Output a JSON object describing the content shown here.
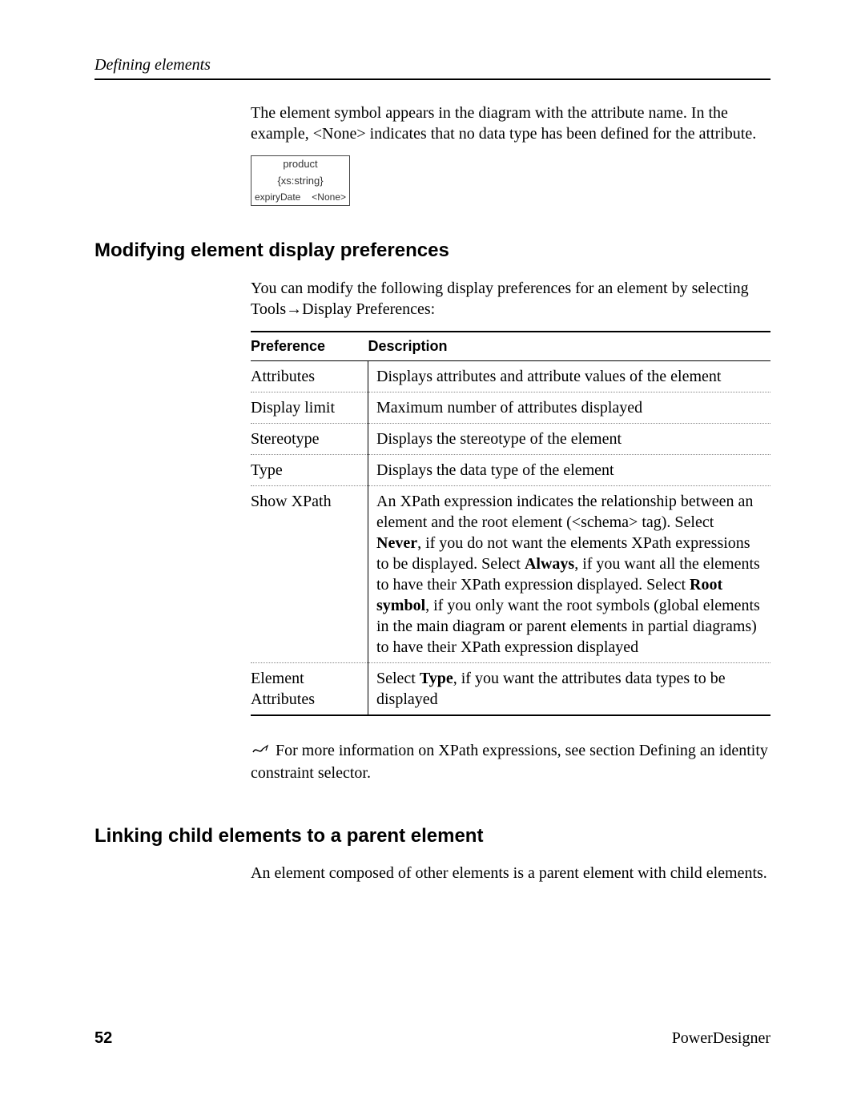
{
  "header": {
    "running_title": "Defining elements"
  },
  "intro_para": "The element symbol appears in the diagram with the attribute name. In the example, <None> indicates that no data type has been defined for the attribute.",
  "diagram": {
    "title": "product",
    "subtitle": "{xs:string}",
    "attr_name": "expiryDate",
    "attr_type": "<None>"
  },
  "section1": {
    "title": "Modifying element display preferences",
    "para_before": "You can modify the following display preferences for an element by selecting Tools",
    "arrow": "→",
    "para_after": "Display Preferences:",
    "table": {
      "col1": "Preference",
      "col2": "Description",
      "rows": [
        {
          "pref": "Attributes",
          "desc": [
            {
              "t": "Displays attributes and attribute values of the element"
            }
          ]
        },
        {
          "pref": "Display limit",
          "desc": [
            {
              "t": "Maximum number of attributes displayed"
            }
          ]
        },
        {
          "pref": "Stereotype",
          "desc": [
            {
              "t": "Displays the stereotype of the element"
            }
          ]
        },
        {
          "pref": "Type",
          "desc": [
            {
              "t": "Displays the data type of the element"
            }
          ]
        },
        {
          "pref": "Show XPath",
          "desc": [
            {
              "t": "An XPath expression indicates the relationship between an element and the root element (<schema> tag). Select "
            },
            {
              "t": "Never",
              "b": true
            },
            {
              "t": ", if you do not want the elements XPath expressions to be displayed. Select "
            },
            {
              "t": "Always",
              "b": true
            },
            {
              "t": ", if you want all the elements to have their XPath expression displayed. Select "
            },
            {
              "t": "Root symbol",
              "b": true
            },
            {
              "t": ", if you only want the root symbols (global elements in the main diagram or parent elements in partial diagrams) to have their XPath expression displayed"
            }
          ]
        },
        {
          "pref": "Element Attributes",
          "desc": [
            {
              "t": "Select "
            },
            {
              "t": "Type",
              "b": true
            },
            {
              "t": ", if you want the attributes data types to be displayed"
            }
          ]
        }
      ]
    },
    "note": "For more information on XPath expressions, see section Defining an identity constraint selector."
  },
  "section2": {
    "title": "Linking child elements to a parent element",
    "para": "An element composed of other elements is a parent element with child elements."
  },
  "footer": {
    "page": "52",
    "product": "PowerDesigner"
  }
}
